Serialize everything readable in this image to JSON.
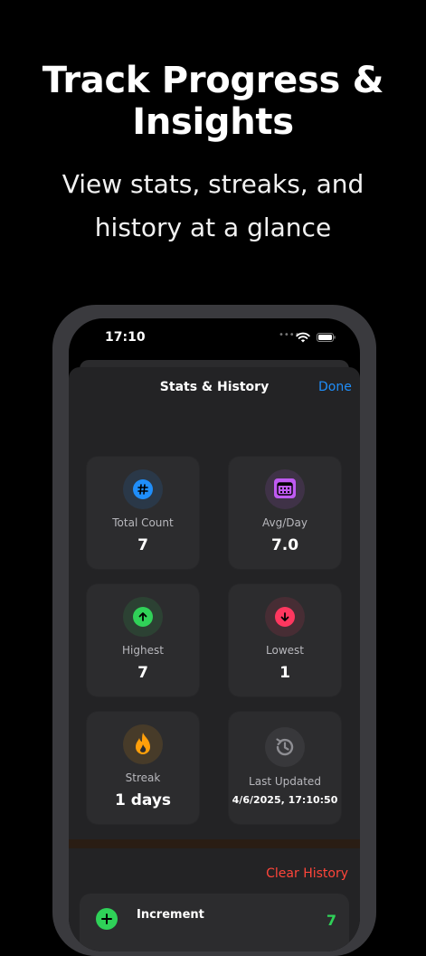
{
  "promo": {
    "headline_line1": "Track Progress &",
    "headline_line2": "Insights",
    "subline_line1": "View stats, streaks, and",
    "subline_line2": "history at a glance"
  },
  "status_bar": {
    "time": "17:10",
    "dots": "••••"
  },
  "nav": {
    "title": "Stats & History",
    "done_label": "Done"
  },
  "cards": [
    {
      "label": "Total Count",
      "value": "7",
      "icon": "hash-icon",
      "color": "#1f8efa"
    },
    {
      "label": "Avg/Day",
      "value": "7.0",
      "icon": "calendar-icon",
      "color": "#bf5af2"
    },
    {
      "label": "Highest",
      "value": "7",
      "icon": "arrow-up-icon",
      "color": "#30d158"
    },
    {
      "label": "Lowest",
      "value": "1",
      "icon": "arrow-down-icon",
      "color": "#ff375f"
    },
    {
      "label": "Streak",
      "value": "1 days",
      "icon": "flame-icon",
      "color": "#ff9f0a"
    },
    {
      "label": "Last Updated",
      "value": "4/6/2025, 17:10:50",
      "icon": "history-icon",
      "color": "#8e8e93"
    }
  ],
  "history": {
    "clear_label": "Clear History",
    "rows": [
      {
        "label": "Increment",
        "value": "7",
        "icon": "plus-circle-icon"
      }
    ]
  }
}
